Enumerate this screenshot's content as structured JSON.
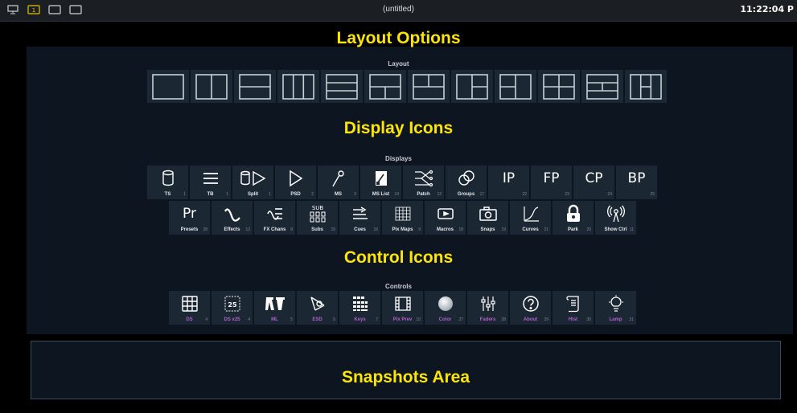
{
  "topbar": {
    "title": "(untitled)",
    "time": "11:22:04 P",
    "icons": [
      "monitor-icon",
      "display-1-icon",
      "display-2-icon",
      "display-3-icon"
    ],
    "display_badge": "1"
  },
  "headings": {
    "layout": "Layout Options",
    "displays": "Display Icons",
    "controls": "Control Icons",
    "snapshots": "Snapshots Area"
  },
  "sections": {
    "layout_label": "Layout",
    "displays_label": "Displays",
    "controls_label": "Controls"
  },
  "layouts": [
    "single",
    "two-columns",
    "two-rows",
    "three-columns",
    "three-rows",
    "top-bottom-split",
    "top-split-bottom",
    "left-right-split",
    "right-left-split",
    "four-quad",
    "three-row-middle-split",
    "three-col-middle-split"
  ],
  "displays_row1": [
    {
      "icon": "cylinder-icon",
      "label": "TS",
      "num": "1"
    },
    {
      "icon": "lines-icon",
      "label": "TB",
      "num": "1"
    },
    {
      "icon": "split-icon",
      "label": "Split",
      "num": "1"
    },
    {
      "icon": "play-icon",
      "label": "PSD",
      "num": "2"
    },
    {
      "icon": "pen-icon",
      "label": "MS",
      "num": "3"
    },
    {
      "icon": "list-icon",
      "label": "MS List",
      "num": "14"
    },
    {
      "icon": "patch-icon",
      "label": "Patch",
      "num": "12"
    },
    {
      "icon": "groups-icon",
      "label": "Groups",
      "num": "17"
    },
    {
      "icon": "text",
      "text": "IP",
      "label": "",
      "num": "22"
    },
    {
      "icon": "text",
      "text": "FP",
      "label": "",
      "num": "23"
    },
    {
      "icon": "text",
      "text": "CP",
      "label": "",
      "num": "24"
    },
    {
      "icon": "text",
      "text": "BP",
      "label": "",
      "num": "25"
    }
  ],
  "displays_row2": [
    {
      "icon": "text",
      "text": "Pr",
      "label": "Presets",
      "num": "28"
    },
    {
      "icon": "wave-icon",
      "label": "Effects",
      "num": "13"
    },
    {
      "icon": "fx-icon",
      "label": "FX Chans",
      "num": "8"
    },
    {
      "icon": "subs-icon",
      "label": "Subs",
      "num": "15"
    },
    {
      "icon": "cues-icon",
      "label": "Cues",
      "num": "16"
    },
    {
      "icon": "grid-icon",
      "label": "Pix Maps",
      "num": "9"
    },
    {
      "icon": "macro-icon",
      "label": "Macros",
      "num": "18"
    },
    {
      "icon": "camera-icon",
      "label": "Snaps",
      "num": "19"
    },
    {
      "icon": "curve-icon",
      "label": "Curves",
      "num": "21"
    },
    {
      "icon": "lock-icon",
      "label": "Park",
      "num": "20"
    },
    {
      "icon": "antenna-icon",
      "label": "Show Ctrl",
      "num": "11"
    }
  ],
  "controls": [
    {
      "icon": "grid4-icon",
      "label": "DS",
      "num": "4"
    },
    {
      "icon": "ds25-icon",
      "label": "DS x25",
      "num": "4"
    },
    {
      "icon": "ml-icon",
      "label": "ML",
      "num": "5"
    },
    {
      "icon": "esd-icon",
      "label": "ESD",
      "num": "6"
    },
    {
      "icon": "keys-icon",
      "label": "Keys",
      "num": "7"
    },
    {
      "icon": "film-icon",
      "label": "Pix Prev",
      "num": "10"
    },
    {
      "icon": "ball-icon",
      "label": "Color",
      "num": "27"
    },
    {
      "icon": "faders-icon",
      "label": "Faders",
      "num": "28"
    },
    {
      "icon": "help-icon",
      "label": "About",
      "num": "29"
    },
    {
      "icon": "scroll-icon",
      "label": "Hist",
      "num": "30"
    },
    {
      "icon": "lamp-icon",
      "label": "Lamp",
      "num": "31"
    }
  ],
  "colors": {
    "heading": "#ffe600",
    "tile": "#1b2733",
    "panel": "#0d1620",
    "control_label": "#b35fd0"
  }
}
